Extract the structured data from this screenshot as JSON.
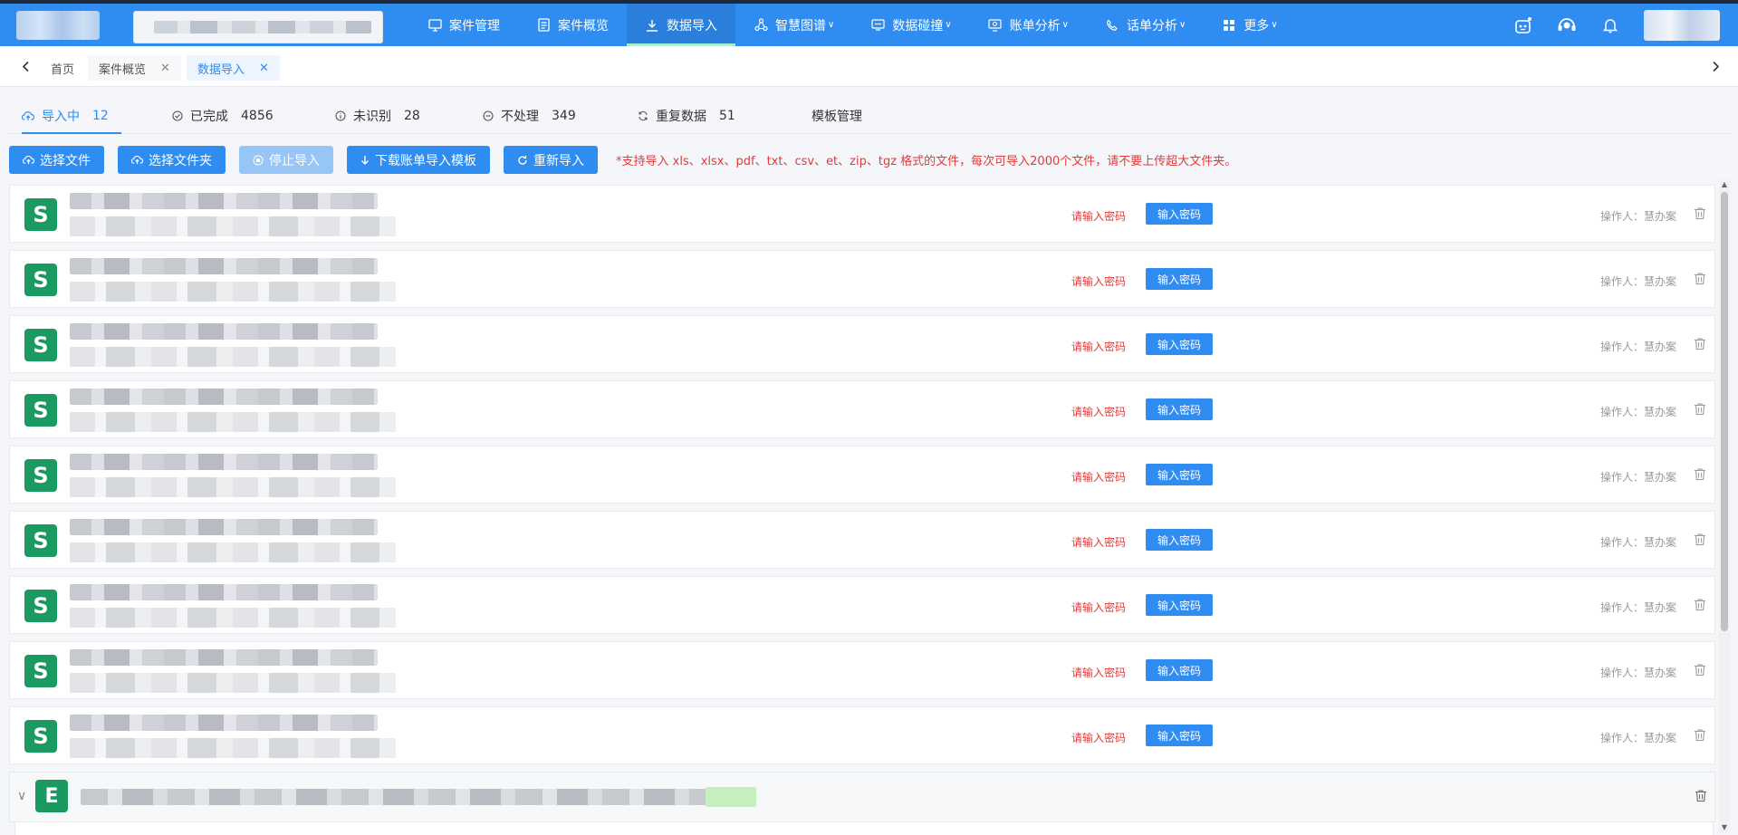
{
  "nav": {
    "items": [
      {
        "label": "案件管理",
        "icon": "monitor-icon",
        "active": false,
        "caret": false
      },
      {
        "label": "案件概览",
        "icon": "document-icon",
        "active": false,
        "caret": false
      },
      {
        "label": "数据导入",
        "icon": "download-icon",
        "active": true,
        "caret": false
      },
      {
        "label": "智慧图谱",
        "icon": "graph-icon",
        "active": false,
        "caret": true
      },
      {
        "label": "数据碰撞",
        "icon": "collision-icon",
        "active": false,
        "caret": true
      },
      {
        "label": "账单分析",
        "icon": "bill-icon",
        "active": false,
        "caret": true
      },
      {
        "label": "话单分析",
        "icon": "phone-icon",
        "active": false,
        "caret": true
      },
      {
        "label": "更多",
        "icon": "grid-icon",
        "active": false,
        "caret": true
      }
    ],
    "caret_char": "∨"
  },
  "tabs": {
    "home": "首页",
    "overview": "案件概览",
    "import": "数据导入",
    "close_char": "✕"
  },
  "status_tabs": [
    {
      "label": "导入中",
      "count": "12",
      "icon": "upload-cloud-icon",
      "active": true
    },
    {
      "label": "已完成",
      "count": "4856",
      "icon": "check-circle-icon",
      "active": false
    },
    {
      "label": "未识别",
      "count": "28",
      "icon": "info-circle-icon",
      "active": false
    },
    {
      "label": "不处理",
      "count": "349",
      "icon": "minus-circle-icon",
      "active": false
    },
    {
      "label": "重复数据",
      "count": "51",
      "icon": "refresh-icon",
      "active": false
    },
    {
      "label": "模板管理",
      "count": "",
      "icon": "",
      "active": false
    }
  ],
  "toolbar": {
    "select_file": "选择文件",
    "select_folder": "选择文件夹",
    "stop_import": "停止导入",
    "download_template": "下载账单导入模板",
    "reimport": "重新导入",
    "hint": "*支持导入 xls、xlsx、pdf、txt、csv、et、zip、tgz 格式的文件，每次可导入2000个文件，请不要上传超大文件夹。"
  },
  "rows": {
    "file_letter": "S",
    "password_tip": "请输入密码",
    "password_button": "输入密码",
    "operator": "操作人：慧办案",
    "count": 9
  },
  "group": {
    "file_letter": "E",
    "chevron": "∨"
  },
  "colors": {
    "primary": "#2f8cf0",
    "danger": "#e23a3a",
    "excel_green": "#1a9a60"
  }
}
